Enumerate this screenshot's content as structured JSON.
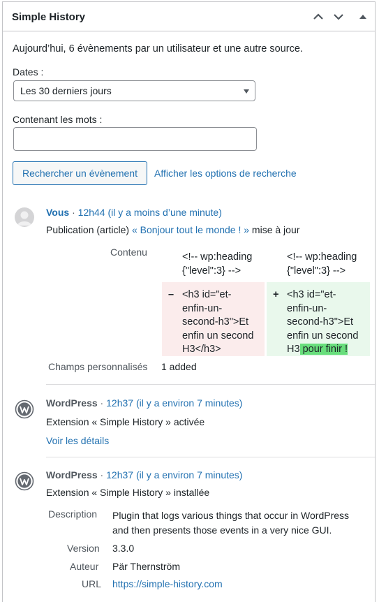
{
  "widget": {
    "title": "Simple History",
    "summary": "Aujourd’hui, 6 évènements par un utilisateur et une autre source."
  },
  "filters": {
    "dates_label": "Dates :",
    "dates_value": "Les 30 derniers jours",
    "words_label": "Contenant les mots :",
    "words_value": "",
    "search_button": "Rechercher un évènement",
    "options_link": "Afficher les options de recherche"
  },
  "events": [
    {
      "initiator": "Vous",
      "sep": " · ",
      "time": "12h44 (il y a moins d’une minute)",
      "message_pre": "Publication (article) ",
      "message_link": "« Bonjour tout le monde ! »",
      "message_post": " mise à jour",
      "diff": {
        "label": "Contenu",
        "old_context": [
          "<!-- wp:heading",
          "{\"level\":3} -->"
        ],
        "new_context": [
          "<!-- wp:heading",
          "{\"level\":3} -->"
        ],
        "del_marker": "–",
        "ins_marker": "+",
        "old_lines": [
          "<h3 id=\"et-",
          "enfin-un-",
          "second-h3\">Et",
          "enfin un second",
          "H3</h3>"
        ],
        "new_lines": [
          "<h3 id=\"et-",
          "enfin-un-",
          "second-h3\">Et",
          "enfin un second"
        ],
        "new_last_pre": "H3",
        "new_last_hl": " pour finir !"
      },
      "custom_fields_label": "Champs personnalisés",
      "custom_fields_value": "1 added"
    },
    {
      "initiator": "WordPress",
      "sep": " · ",
      "time": "12h37 (il y a environ 7 minutes)",
      "message": "Extension « Simple History » activée",
      "details_link": "Voir les détails"
    },
    {
      "initiator": "WordPress",
      "sep": " · ",
      "time": "12h37 (il y a environ 7 minutes)",
      "message": "Extension « Simple History » installée",
      "details": {
        "description_label": "Description",
        "description_lines": [
          "Plugin that logs various things that occur in WordPress",
          "and then presents those events in a very nice GUI."
        ],
        "version_label": "Version",
        "version": "3.3.0",
        "author_label": "Auteur",
        "author": "Pär Thernström",
        "url_label": "URL",
        "url": "https://simple-history.com"
      }
    }
  ]
}
